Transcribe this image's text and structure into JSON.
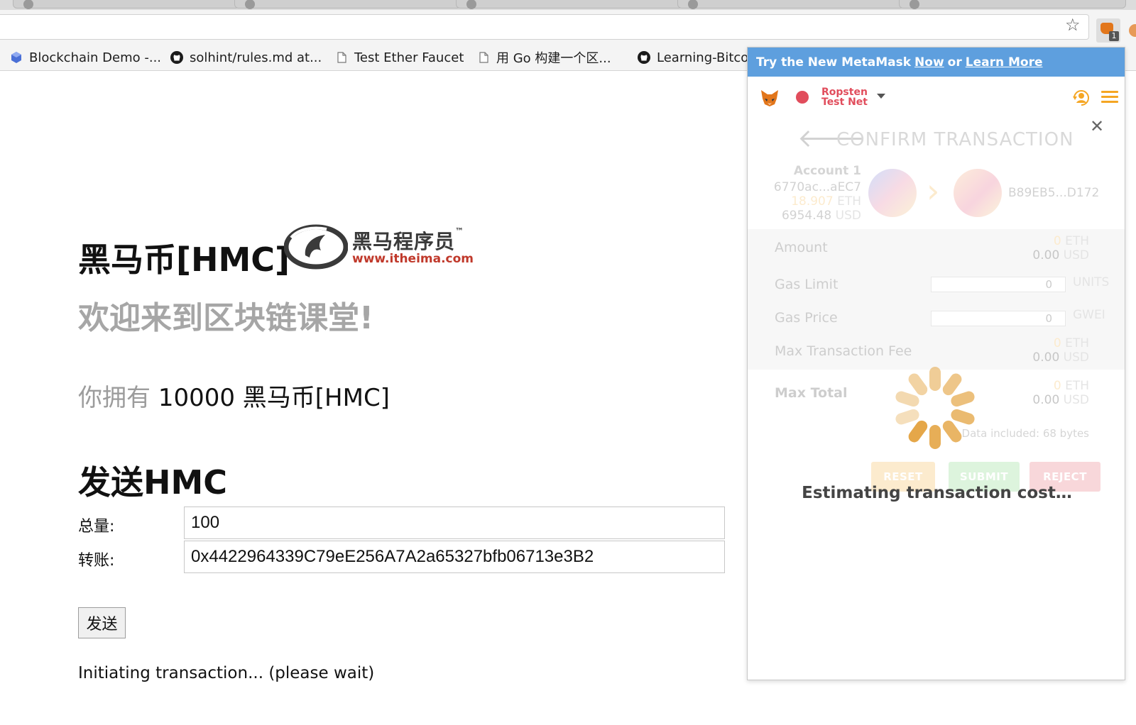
{
  "browser": {
    "bookmarks": [
      {
        "label": "Blockchain Demo -...",
        "icon": "cube-icon"
      },
      {
        "label": "solhint/rules.md at...",
        "icon": "github-icon"
      },
      {
        "label": "Test Ether Faucet",
        "icon": "page-icon"
      },
      {
        "label": "用 Go 构建一个区...",
        "icon": "page-icon"
      },
      {
        "label": "Learning-Bitco",
        "icon": "github-icon"
      }
    ],
    "extension_badge": "1"
  },
  "page": {
    "title": "黑马币[HMC]",
    "logo": {
      "brand": "黑马程序员",
      "tm": "™",
      "url": "www.itheima.com"
    },
    "subtitle": "欢迎来到区块链课堂!",
    "balance_label": "你拥有",
    "balance_value": "10000 黑马币[HMC]",
    "send_heading": "发送HMC",
    "amount_label": "总量:",
    "amount_value": "100",
    "to_label": "转账:",
    "to_value": "0x4422964339C79eE256A7A2a65327bfb06713e3B2",
    "send_button": "发送",
    "status": "Initiating transaction... (please wait)"
  },
  "metamask": {
    "banner": {
      "prefix": "Try the New MetaMask",
      "now": "Now",
      "or": "or",
      "learn_more": "Learn More"
    },
    "network": {
      "line1": "Ropsten",
      "line2": "Test Net",
      "color": "#e14d5c"
    },
    "title": "CONFIRM TRANSACTION",
    "from": {
      "name": "Account 1",
      "address": "6770ac...aEC7",
      "eth_amount": "18.907",
      "eth_unit": "ETH",
      "usd_amount": "6954.48",
      "usd_unit": "USD"
    },
    "to": {
      "address": "B89EB5...D172"
    },
    "amount": {
      "label": "Amount",
      "eth": "0",
      "eth_unit": "ETH",
      "usd": "0.00",
      "usd_unit": "USD"
    },
    "gas_limit": {
      "label": "Gas Limit",
      "value": "0",
      "unit": "UNITS"
    },
    "gas_price": {
      "label": "Gas Price",
      "value": "0",
      "unit": "GWEI"
    },
    "max_fee": {
      "label": "Max Transaction Fee",
      "eth": "0",
      "eth_unit": "ETH",
      "usd": "0.00",
      "usd_unit": "USD"
    },
    "max_total": {
      "label": "Max Total",
      "eth": "0",
      "eth_unit": "ETH",
      "usd": "0.00",
      "usd_unit": "USD"
    },
    "data_included": "Data included: 68 bytes",
    "buttons": {
      "reset": "RESET",
      "submit": "SUBMIT",
      "reject": "REJECT"
    },
    "loading_text": "Estimating transaction cost…",
    "colors": {
      "accent": "#f5a623",
      "banner": "#5e9fde",
      "submit": "#6ad268",
      "reject": "#e14d5c"
    }
  }
}
